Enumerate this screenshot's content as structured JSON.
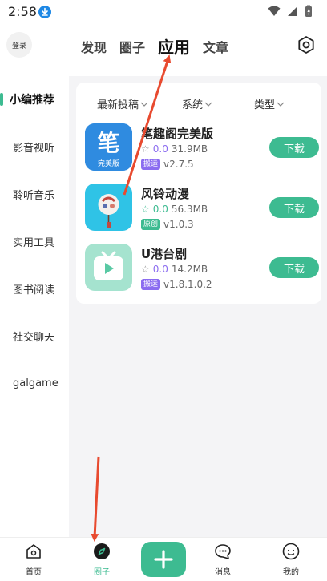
{
  "status_bar": {
    "time": "2:58"
  },
  "header": {
    "login_label": "登录",
    "tabs": [
      {
        "label": "发现"
      },
      {
        "label": "圈子"
      },
      {
        "label": "应用",
        "active": true
      },
      {
        "label": "文章"
      }
    ]
  },
  "sidebar": {
    "items": [
      {
        "label": "小编推荐",
        "active": true
      },
      {
        "label": "影音视听"
      },
      {
        "label": "聆听音乐"
      },
      {
        "label": "实用工具"
      },
      {
        "label": "图书阅读"
      },
      {
        "label": "社交聊天"
      },
      {
        "label": "galgame"
      }
    ]
  },
  "filters": [
    {
      "label": "最新投稿"
    },
    {
      "label": "系统"
    },
    {
      "label": "类型"
    }
  ],
  "apps": [
    {
      "name": "笔趣阁完美版",
      "rating": "0.0",
      "size": "31.9MB",
      "tag": "搬运",
      "tag_color": "#8b6cf0",
      "version": "v2.7.5",
      "download_label": "下载",
      "icon_text": "笔",
      "icon_subtext": "完美版"
    },
    {
      "name": "风铃动漫",
      "rating": "0.0",
      "size": "56.3MB",
      "tag": "原创",
      "tag_color": "#3dbb91",
      "version": "v1.0.3",
      "download_label": "下载"
    },
    {
      "name": "U港台剧",
      "rating": "0.0",
      "size": "14.2MB",
      "tag": "搬运",
      "tag_color": "#8b6cf0",
      "version": "v1.8.1.0.2",
      "download_label": "下载"
    }
  ],
  "bottom_nav": [
    {
      "label": "首页"
    },
    {
      "label": "圈子",
      "active": true
    },
    {
      "label": "消息"
    },
    {
      "label": "我的"
    }
  ],
  "colors": {
    "accent": "#3dbb91",
    "annotation_red": "#e84a2f"
  }
}
